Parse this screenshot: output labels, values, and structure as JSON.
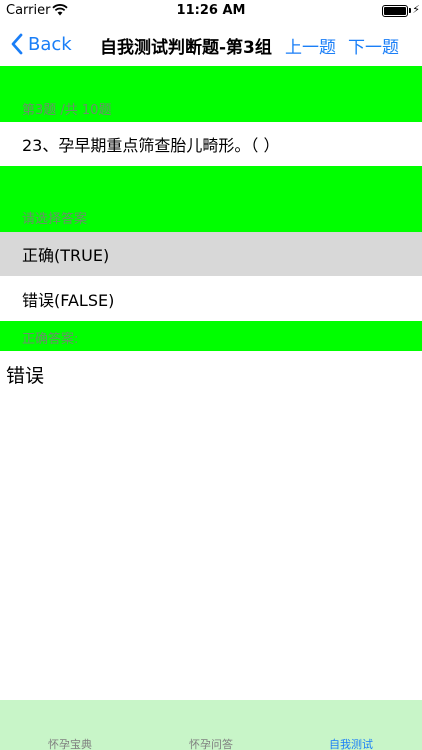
{
  "status_bar": {
    "carrier": "Carrier",
    "time": "11:26 AM"
  },
  "nav": {
    "back_label": "Back",
    "title": "自我测试判断题-第3组",
    "prev_label": "上一题",
    "next_label": "下一题"
  },
  "question": {
    "progress": "第3题 /共 10题",
    "text": "23、孕早期重点筛查胎儿畸形。（ ）"
  },
  "options": {
    "prompt": "请选择答案",
    "items": [
      {
        "label": "正确(TRUE)",
        "selected": true
      },
      {
        "label": "错误(FALSE)",
        "selected": false
      }
    ]
  },
  "correct": {
    "label": "正确答案:",
    "value": "错误"
  },
  "tabs": [
    {
      "label": "怀孕宝典",
      "active": false
    },
    {
      "label": "怀孕问答",
      "active": false
    },
    {
      "label": "自我测试",
      "active": true
    }
  ],
  "colors": {
    "accent": "#1a7ef7",
    "section": "#00ff00",
    "tab_bar": "#c8f5c8",
    "selected_row": "#d8d8d8"
  }
}
